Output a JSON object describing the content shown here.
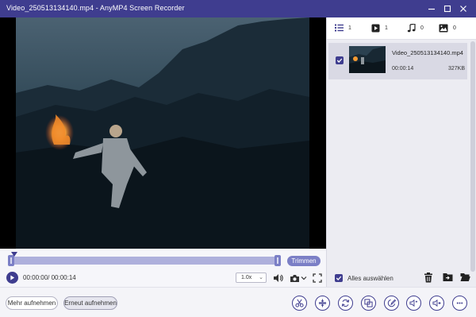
{
  "window": {
    "title": "Video_250513134140.mp4 - AnyMP4 Screen Recorder"
  },
  "player": {
    "trim_label": "Trimmen",
    "time": "00:00:00/ 00:00:14",
    "speed": "1.0x"
  },
  "bottom": {
    "more_record_label": "Mehr aufnehmen",
    "re_record_label": "Erneut aufnehmen"
  },
  "panel": {
    "stats": [
      {
        "icon": "list-icon",
        "count": "1"
      },
      {
        "icon": "video-icon",
        "count": "1"
      },
      {
        "icon": "music-icon",
        "count": "0"
      },
      {
        "icon": "image-icon",
        "count": "0"
      }
    ],
    "item": {
      "filename": "Video_250513134140.mp4",
      "duration": "00:00:14",
      "size": "327KB"
    },
    "select_all_label": "Alles auswählen"
  },
  "colors": {
    "accent": "#3f3d8f",
    "trim_track": "#aeb0dc",
    "trim_button": "#7b7fc6"
  }
}
